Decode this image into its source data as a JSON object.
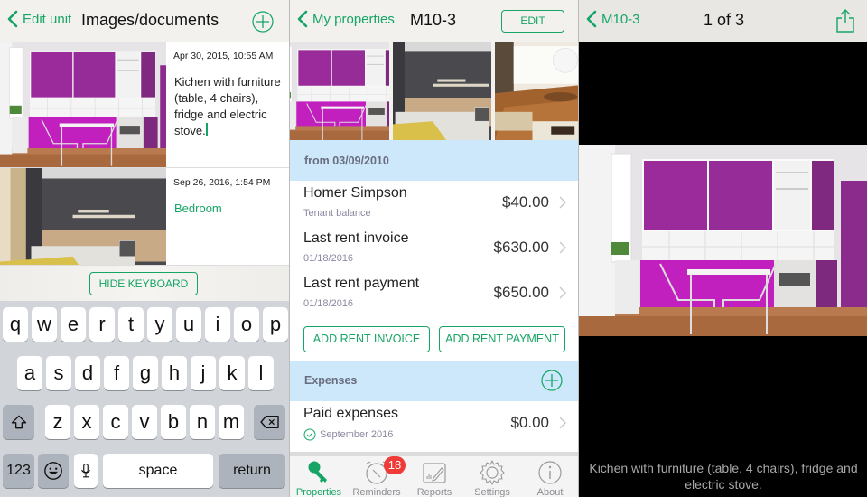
{
  "colors": {
    "accent": "#16a565",
    "section_bg": "#cce8fa",
    "badge": "#f03a37"
  },
  "screen1": {
    "nav": {
      "back_label": "Edit unit",
      "title": "Images/documents",
      "add_icon": "plus-circle-icon"
    },
    "documents": [
      {
        "image": "kitchen-photo",
        "date": "Apr 30, 2015, 10:55 AM",
        "description": "Kichen with furniture (table, 4 chairs), fridge and electric stove.",
        "editing": true
      },
      {
        "image": "bedroom-photo",
        "date": "Sep 26, 2016, 1:54 PM",
        "description": "Bedroom",
        "editing": false
      }
    ],
    "hide_keyboard_label": "HIDE KEYBOARD",
    "keyboard": {
      "row1": [
        "q",
        "w",
        "e",
        "r",
        "t",
        "y",
        "u",
        "i",
        "o",
        "p"
      ],
      "row2": [
        "a",
        "s",
        "d",
        "f",
        "g",
        "h",
        "j",
        "k",
        "l"
      ],
      "row3": [
        "z",
        "x",
        "c",
        "v",
        "b",
        "n",
        "m"
      ],
      "shift_icon": "shift-icon",
      "delete_icon": "backspace-icon",
      "numbers_label": "123",
      "emoji_icon": "emoji-icon",
      "mic_icon": "microphone-icon",
      "space_label": "space",
      "return_label": "return"
    }
  },
  "screen2": {
    "nav": {
      "back_label": "My properties",
      "title": "M10-3",
      "edit_label": "EDIT"
    },
    "gallery": [
      "kitchen-photo",
      "bedroom-photo",
      "living-room-photo"
    ],
    "rent_section": {
      "header": "from 03/09/2010",
      "rows": [
        {
          "title": "Homer Simpson",
          "subtitle": "Tenant balance",
          "amount": "$40.00"
        },
        {
          "title": "Last rent invoice",
          "subtitle": "01/18/2016",
          "amount": "$630.00"
        },
        {
          "title": "Last rent payment",
          "subtitle": "01/18/2016",
          "amount": "$650.00"
        }
      ],
      "add_invoice_label": "ADD RENT INVOICE",
      "add_payment_label": "ADD RENT PAYMENT"
    },
    "expenses_section": {
      "header": "Expenses",
      "rows": [
        {
          "title": "Paid expenses",
          "subtitle": "September 2016",
          "amount": "$0.00",
          "status_icon": "check-circle-icon"
        }
      ]
    },
    "tabbar": [
      {
        "label": "Properties",
        "icon": "key-icon",
        "active": true
      },
      {
        "label": "Reminders",
        "icon": "alarm-clock-icon",
        "active": false,
        "badge": "18"
      },
      {
        "label": "Reports",
        "icon": "chart-pen-icon",
        "active": false
      },
      {
        "label": "Settings",
        "icon": "gear-icon",
        "active": false
      },
      {
        "label": "About",
        "icon": "info-icon",
        "active": false
      }
    ]
  },
  "screen3": {
    "nav": {
      "back_label": "M10-3",
      "title": "1 of 3",
      "share_icon": "share-icon"
    },
    "image": "kitchen-photo",
    "caption": "Kichen with furniture (table, 4 chairs), fridge and electric stove."
  }
}
